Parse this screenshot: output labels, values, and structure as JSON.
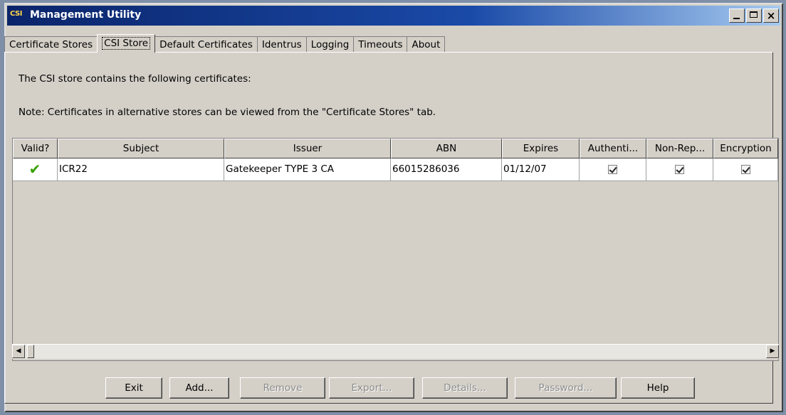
{
  "window": {
    "logo": "CSI",
    "title": "Management Utility"
  },
  "tabs": [
    {
      "label": "Certificate Stores",
      "active": false
    },
    {
      "label": "CSI Store",
      "active": true
    },
    {
      "label": "Default Certificates",
      "active": false
    },
    {
      "label": "Identrus",
      "active": false
    },
    {
      "label": "Logging",
      "active": false
    },
    {
      "label": "Timeouts",
      "active": false
    },
    {
      "label": "About",
      "active": false
    }
  ],
  "panel": {
    "intro": "The CSI store contains the following certificates:",
    "note": "Note: Certificates in alternative stores can be viewed from the \"Certificate Stores\" tab."
  },
  "table": {
    "columns": [
      "Valid?",
      "Subject",
      "Issuer",
      "ABN",
      "Expires",
      "Authenti...",
      "Non-Rep...",
      "Encryption"
    ],
    "rows": [
      {
        "valid_icon": "green-checkmark-icon",
        "subject": "ICR22",
        "issuer": "Gatekeeper TYPE 3 CA",
        "abn": "66015286036",
        "expires": "01/12/07",
        "authentication": true,
        "non_repudiation": true,
        "encryption": true
      }
    ]
  },
  "buttons": {
    "exit": "Exit",
    "add": "Add...",
    "remove": "Remove",
    "export": "Export...",
    "details": "Details...",
    "password": "Password...",
    "help": "Help"
  },
  "colors": {
    "title_bar": "#0a246a",
    "face": "#d4d0c8",
    "valid_check": "#33a000"
  }
}
